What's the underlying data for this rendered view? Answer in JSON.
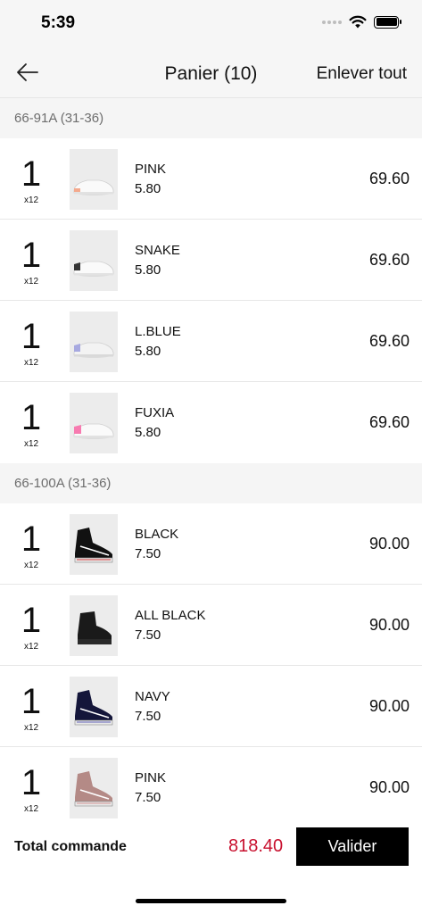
{
  "status": {
    "time": "5:39"
  },
  "nav": {
    "title": "Panier (10)",
    "clear_all": "Enlever tout"
  },
  "groups": [
    {
      "title": "66-91A (31-36)",
      "items": [
        {
          "qty": "1",
          "pack": "x12",
          "name": "PINK",
          "unit_price": "5.80",
          "price": "69.60",
          "image": "sneaker-white-pink-heel"
        },
        {
          "qty": "1",
          "pack": "x12",
          "name": "SNAKE",
          "unit_price": "5.80",
          "price": "69.60",
          "image": "sneaker-white-snake-heel"
        },
        {
          "qty": "1",
          "pack": "x12",
          "name": "L.BLUE",
          "unit_price": "5.80",
          "price": "69.60",
          "image": "sneaker-white-blue-heel"
        },
        {
          "qty": "1",
          "pack": "x12",
          "name": "FUXIA",
          "unit_price": "5.80",
          "price": "69.60",
          "image": "sneaker-white-fuxia-heel"
        }
      ]
    },
    {
      "title": "66-100A (31-36)",
      "items": [
        {
          "qty": "1",
          "pack": "x12",
          "name": "BLACK",
          "unit_price": "7.50",
          "price": "90.00",
          "image": "sock-sneaker-black"
        },
        {
          "qty": "1",
          "pack": "x12",
          "name": "ALL BLACK",
          "unit_price": "7.50",
          "price": "90.00",
          "image": "ankle-boot-black"
        },
        {
          "qty": "1",
          "pack": "x12",
          "name": "NAVY",
          "unit_price": "7.50",
          "price": "90.00",
          "image": "sock-sneaker-navy"
        },
        {
          "qty": "1",
          "pack": "x12",
          "name": "PINK",
          "unit_price": "7.50",
          "price": "90.00",
          "image": "sock-sneaker-pink"
        }
      ]
    }
  ],
  "footer": {
    "total_label": "Total commande",
    "total_value": "818.40",
    "validate_label": "Valider"
  },
  "colors": {
    "accent_total": "#c8102e",
    "button_bg": "#000000",
    "header_bg": "#f6f6f6"
  }
}
